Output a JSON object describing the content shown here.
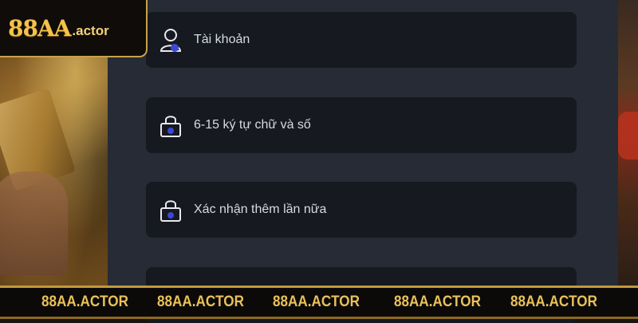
{
  "logo": {
    "main": "88AA",
    "suffix": ".actor"
  },
  "form": {
    "fields": [
      {
        "placeholder": "Tài khoản",
        "icon": "user-icon"
      },
      {
        "placeholder": "6-15 ký tự chữ và số",
        "icon": "lock-icon"
      },
      {
        "placeholder": "Xác nhận thêm lần nữa",
        "icon": "lock-icon"
      },
      {
        "placeholder": "",
        "icon": "lock-icon"
      }
    ]
  },
  "footer": {
    "labels": [
      "88AA.ACTOR",
      "88AA.ACTOR",
      "88AA.ACTOR",
      "88AA.ACTOR",
      "88AA.ACTOR"
    ]
  },
  "colors": {
    "panel": "#262b35",
    "field": "#16191f",
    "accent_gold": "#e9c15a",
    "icon_blue": "#3d47d6"
  }
}
